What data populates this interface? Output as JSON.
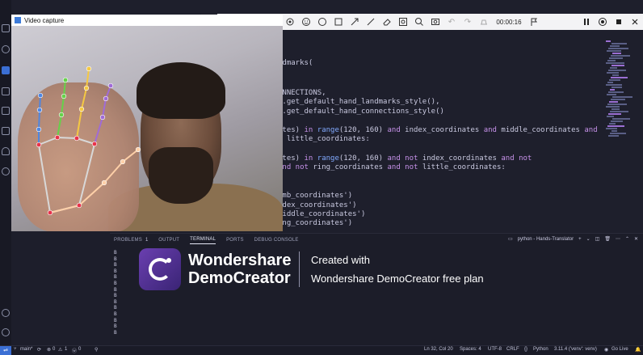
{
  "video_window": {
    "title": "Video capture"
  },
  "toolbar": {
    "timer": "00:00:16",
    "tools": [
      "expand-icon",
      "select-icon",
      "pen-icon",
      "highlighter-icon",
      "text-icon",
      "shapes-icon",
      "emoji-icon",
      "circle-icon",
      "rectangle-icon",
      "arrow-icon",
      "line-icon",
      "eraser-icon",
      "spotlight-icon",
      "screenshot-icon",
      "zoom-icon",
      "undo-icon",
      "redo-icon",
      "clear-icon"
    ],
    "controls": [
      "pause-icon",
      "webcam-icon",
      "stop-icon",
      "close-icon"
    ]
  },
  "editor": {
    "lines": [
      {
        "segments": [
          {
            "text": "ndmarks(",
            "cls": ""
          }
        ]
      },
      {
        "segments": [
          {
            "text": "ONNECTIONS,",
            "cls": ""
          }
        ]
      },
      {
        "segments": [
          {
            "text": "s.get_default_hand_landmarks_style(),",
            "cls": ""
          }
        ]
      },
      {
        "segments": [
          {
            "text": "s.get_default_hand_connections_style()",
            "cls": ""
          }
        ]
      },
      {
        "segments": [
          {
            "text": "ates) ",
            "cls": ""
          },
          {
            "text": "in ",
            "cls": "kw"
          },
          {
            "text": "range",
            "cls": "fn"
          },
          {
            "text": "(120, 160) ",
            "cls": ""
          },
          {
            "text": "and ",
            "cls": "kw"
          },
          {
            "text": "index_coordinates ",
            "cls": ""
          },
          {
            "text": "and ",
            "cls": "kw"
          },
          {
            "text": "middle_coordinates ",
            "cls": ""
          },
          {
            "text": "and",
            "cls": "kw"
          }
        ]
      },
      {
        "segments": [
          {
            "text": "d little_coordinates:",
            "cls": ""
          }
        ]
      },
      {
        "segments": [
          {
            "text": "ates) ",
            "cls": ""
          },
          {
            "text": "in ",
            "cls": "kw"
          },
          {
            "text": "range",
            "cls": "fn"
          },
          {
            "text": "(120, 160) ",
            "cls": ""
          },
          {
            "text": "and not ",
            "cls": "kw"
          },
          {
            "text": "index_coordinates ",
            "cls": ""
          },
          {
            "text": "and not",
            "cls": "kw"
          }
        ]
      },
      {
        "segments": [
          {
            "text": "and not ",
            "cls": "kw"
          },
          {
            "text": "ring_coordinates ",
            "cls": ""
          },
          {
            "text": "and not ",
            "cls": "kw"
          },
          {
            "text": "little_coordinates:",
            "cls": ""
          }
        ]
      },
      {
        "segments": [
          {
            "text": "umb_coordinates')",
            "cls": ""
          }
        ]
      },
      {
        "segments": [
          {
            "text": "ndex_coordinates')",
            "cls": ""
          }
        ]
      },
      {
        "segments": [
          {
            "text": "middle_coordinates')",
            "cls": ""
          }
        ]
      },
      {
        "segments": [
          {
            "text": "ing_coordinates')",
            "cls": ""
          }
        ]
      }
    ]
  },
  "panel": {
    "tabs": [
      {
        "label": "PROBLEMS",
        "count": "1"
      },
      {
        "label": "OUTPUT"
      },
      {
        "label": "TERMINAL",
        "active": true
      },
      {
        "label": "PORTS"
      },
      {
        "label": "DEBUG CONSOLE"
      }
    ],
    "terminal_name": "python - Hands-Translator",
    "term_lines": [
      "B",
      "B",
      "B",
      "B",
      "B",
      "B",
      "B",
      "B",
      "B",
      "B",
      "B",
      "B",
      "B",
      "B"
    ]
  },
  "watermark": {
    "brand_line1": "Wondershare",
    "brand_line2": "DemoCreator",
    "line1": "Created with",
    "line2": "Wondershare DemoCreator free plan"
  },
  "statusbar": {
    "branch": "main*",
    "errors": "0",
    "warnings": "1",
    "info": "0",
    "position": "Ln 32, Col 20",
    "spaces": "Spaces: 4",
    "encoding": "UTF-8",
    "eol": "CRLF",
    "language": "Python",
    "interpreter": "3.11.4 ('venv': venv)",
    "golive": "Go Live"
  },
  "colors": {
    "accent": "#3b6fd4",
    "landmark_red": "#e8334a",
    "thumb": "#ffd0a8",
    "index": "#a06bd6",
    "middle": "#f5c842",
    "ring": "#66d14a",
    "pinky": "#4f86e0"
  }
}
